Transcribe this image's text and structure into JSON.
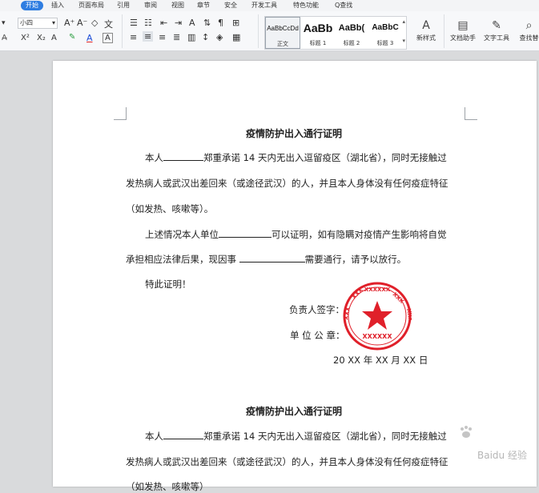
{
  "menu": {
    "tabs": [
      {
        "label": "开始"
      },
      {
        "label": "插入"
      },
      {
        "label": "页面布局"
      },
      {
        "label": "引用"
      },
      {
        "label": "审阅"
      },
      {
        "label": "视图"
      },
      {
        "label": "章节"
      },
      {
        "label": "安全"
      },
      {
        "label": "开发工具"
      },
      {
        "label": "特色功能"
      }
    ],
    "search": "Q查找"
  },
  "ribbon": {
    "font_size": "小四",
    "styles": [
      {
        "preview": "AaBbCcDd",
        "label": "正文"
      },
      {
        "preview": "AaBb",
        "label": "标题 1"
      },
      {
        "preview": "AaBb(",
        "label": "标题 2"
      },
      {
        "preview": "AaBbC",
        "label": "标题 3"
      }
    ],
    "new_style": "新样式",
    "doc_helper": "文档助手",
    "text_tools": "文字工具",
    "find": "查找替"
  },
  "document": {
    "title": "疫情防护出入通行证明",
    "p1_a": "本人",
    "p1_b": "郑重承诺 14 天内无出入逗留疫区（湖北省），同时无接触过",
    "p1_line2": "发热病人或武汉出差回来（或途径武汉）的人，并且本人身体没有任何疫症特征",
    "p1_line3": "（如发热、咳嗽等）。",
    "p2_a": "上述情况本人单位",
    "p2_b": "可以证明，如有隐瞒对疫情产生影响将自觉",
    "p2_line2_a": "承担相应法律后果，现因事",
    "p2_line2_b": "需要通行，请予以放行。",
    "p3": "特此证明！",
    "signer": "负责人签字：",
    "seal": "单 位 公 章：",
    "date": "20 XX 年  XX 月 XX 日",
    "stamp_text": "XXXXXX",
    "title2": "疫情防护出入通行证明",
    "p1_line3_partial": "（如发热、咳嗽等）"
  },
  "watermark": "Baidu 经验"
}
